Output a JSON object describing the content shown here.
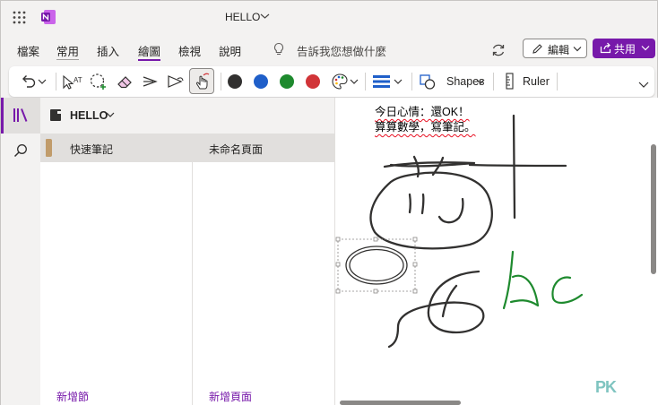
{
  "app": {
    "title": "HELLO"
  },
  "ribbon": {
    "tabs": [
      "檔案",
      "常用",
      "插入",
      "繪圖",
      "檢視",
      "說明"
    ],
    "active_tab": "繪圖",
    "tell_me": "告訴我您想做什麼",
    "edit_label": "編輯",
    "share_label": "共用"
  },
  "toolbar": {
    "shapes_label": "Shapes",
    "ruler_label": "Ruler",
    "pen_colors": [
      "#323130",
      "#1f5fc9",
      "#1e8a2e",
      "#d13438"
    ]
  },
  "notebook": {
    "name": "HELLO",
    "sections": [
      "快速筆記"
    ],
    "pages": [
      "未命名頁面"
    ],
    "add_section": "新增節",
    "add_page": "新增頁面"
  },
  "page": {
    "lines": [
      "今日心情：還OK！",
      "算算數學，寫筆記。"
    ]
  },
  "watermark": "PK",
  "colors": {
    "accent": "#7719aa",
    "ink_black": "#323130",
    "ink_green": "#1e8a2e"
  }
}
